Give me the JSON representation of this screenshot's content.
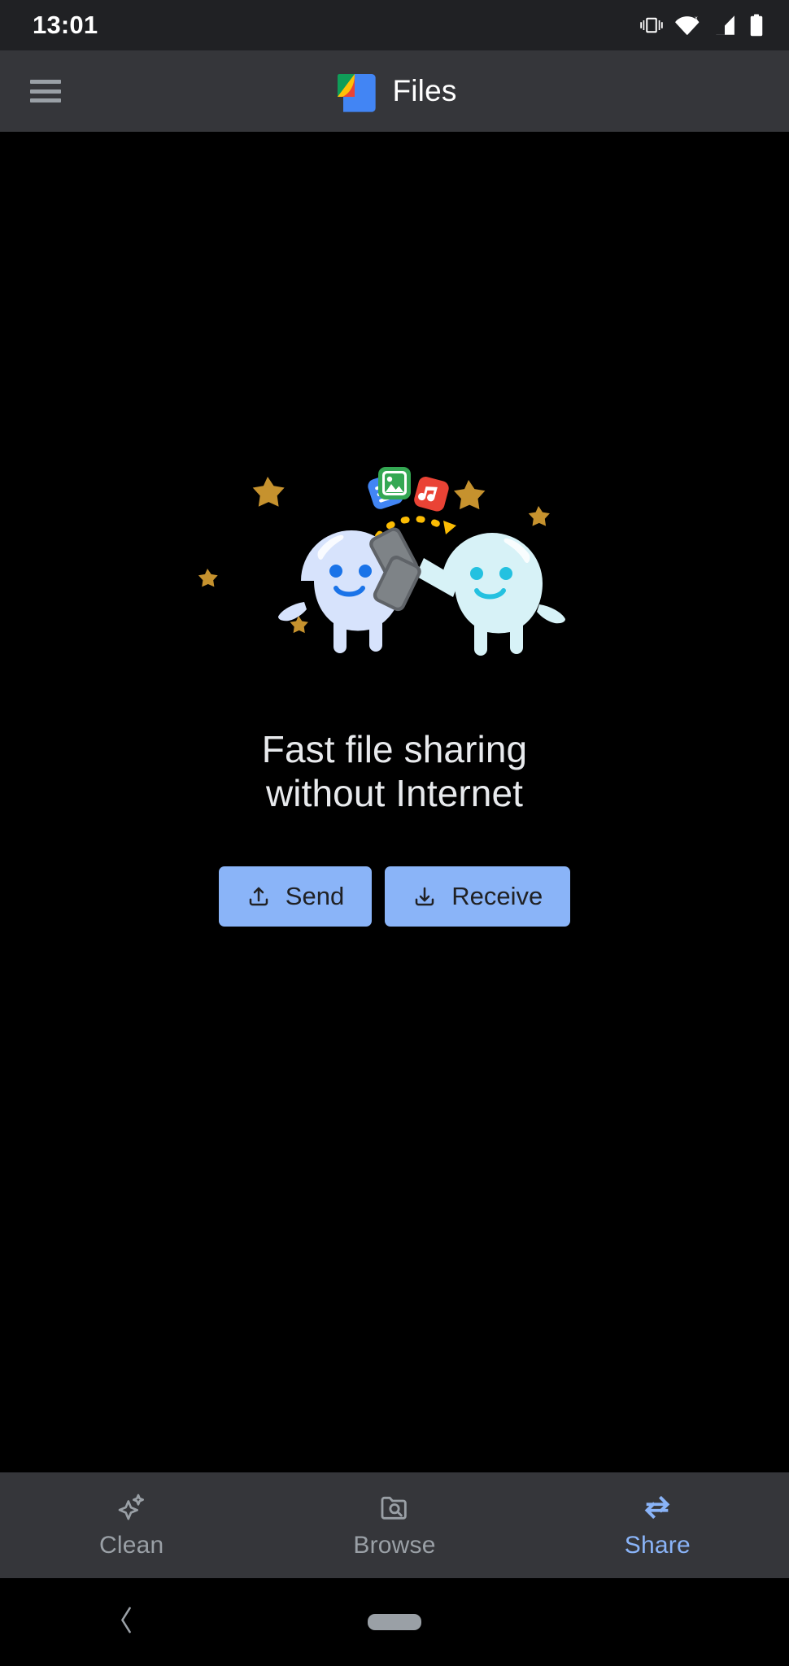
{
  "status_bar": {
    "clock": "13:01",
    "icons": [
      {
        "name": "vibrate-icon",
        "label": "Vibrate mode"
      },
      {
        "name": "wifi-no-internet-icon",
        "label": "Wi-Fi no internet"
      },
      {
        "name": "signal-bars-icon",
        "label": "Mobile signal"
      },
      {
        "name": "battery-icon",
        "label": "Battery full"
      }
    ]
  },
  "app_bar": {
    "menu_icon": "hamburger-menu-icon",
    "logo_icon": "files-by-google-logo",
    "title": "Files"
  },
  "hero": {
    "illustration_name": "two-characters-sharing-files-illustration",
    "headline_line1": "Fast file sharing",
    "headline_line2": "without Internet",
    "file_badges": [
      {
        "name": "document-file-icon",
        "color": "#4285F4"
      },
      {
        "name": "image-file-icon",
        "color": "#34A853"
      },
      {
        "name": "music-file-icon",
        "color": "#EA4335"
      }
    ],
    "transfer_arc_color": "#FBBC04",
    "star_color": "#C6922E",
    "character_left_color": "#D7E3FC",
    "character_right_color": "#D7F2F7"
  },
  "actions": {
    "send": {
      "label": "Send",
      "icon": "upload-icon"
    },
    "receive": {
      "label": "Receive",
      "icon": "download-icon"
    },
    "button_color": "#8AB4F8",
    "button_text_color": "#202124"
  },
  "bottom_nav": {
    "active": "Share",
    "items": [
      {
        "label": "Clean",
        "icon": "sparkle-icon",
        "active": false
      },
      {
        "label": "Browse",
        "icon": "folder-search-icon",
        "active": false
      },
      {
        "label": "Share",
        "icon": "swap-arrows-icon",
        "active": true
      }
    ],
    "inactive_color": "#9AA0A6",
    "active_color": "#8AB4F8"
  },
  "system_nav": {
    "back": "back-chevron-icon",
    "home": "home-pill-icon"
  }
}
